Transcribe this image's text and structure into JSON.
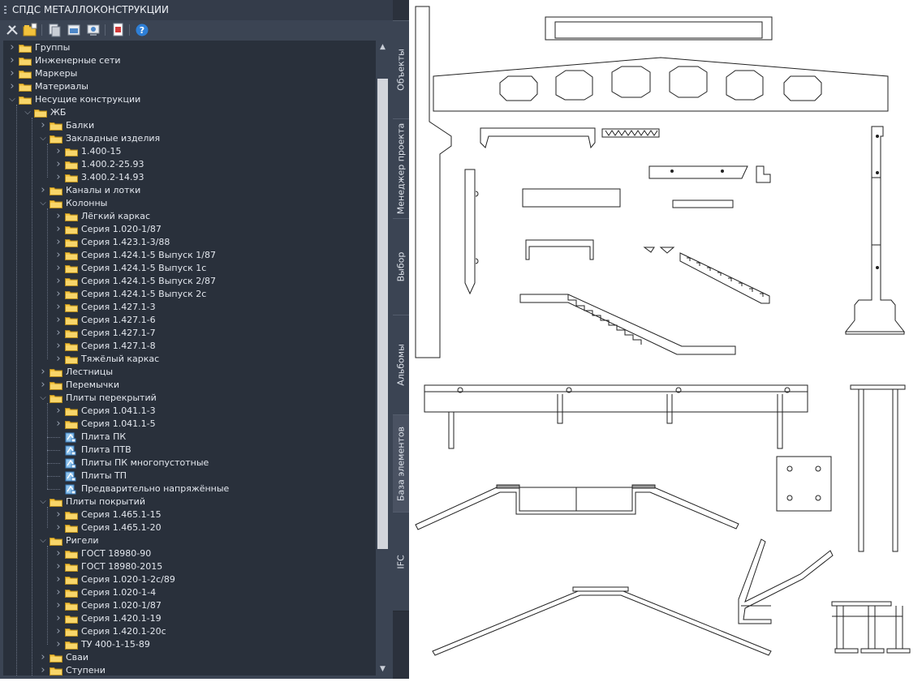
{
  "panel": {
    "title": "СПДС МЕТАЛЛОКОНСТРУКЦИИ"
  },
  "toolbar": [
    {
      "icon": "tools-icon"
    },
    {
      "icon": "open-folder-icon"
    },
    {
      "icon": "copy-icon"
    },
    {
      "icon": "export-icon"
    },
    {
      "icon": "preview-icon"
    },
    {
      "icon": "document-icon"
    },
    {
      "icon": "help-icon"
    }
  ],
  "tree": [
    {
      "level": 0,
      "label": "Группы",
      "expanded": false,
      "type": "folder"
    },
    {
      "level": 0,
      "label": "Инженерные сети",
      "expanded": false,
      "type": "folder"
    },
    {
      "level": 0,
      "label": "Маркеры",
      "expanded": false,
      "type": "folder"
    },
    {
      "level": 0,
      "label": "Материалы",
      "expanded": false,
      "type": "folder"
    },
    {
      "level": 0,
      "label": "Несущие конструкции",
      "expanded": true,
      "type": "folder"
    },
    {
      "level": 1,
      "label": "ЖБ",
      "expanded": true,
      "type": "folder"
    },
    {
      "level": 2,
      "label": "Балки",
      "expanded": false,
      "type": "folder"
    },
    {
      "level": 2,
      "label": "Закладные изделия",
      "expanded": true,
      "type": "folder"
    },
    {
      "level": 3,
      "label": "1.400-15",
      "expanded": false,
      "type": "folder"
    },
    {
      "level": 3,
      "label": "1.400.2-25.93",
      "expanded": false,
      "type": "folder"
    },
    {
      "level": 3,
      "label": "3.400.2-14.93",
      "expanded": false,
      "type": "folder"
    },
    {
      "level": 2,
      "label": "Каналы и лотки",
      "expanded": false,
      "type": "folder"
    },
    {
      "level": 2,
      "label": "Колонны",
      "expanded": true,
      "type": "folder"
    },
    {
      "level": 3,
      "label": "Лёгкий каркас",
      "expanded": false,
      "type": "folder"
    },
    {
      "level": 3,
      "label": "Серия 1.020-1/87",
      "expanded": false,
      "type": "folder"
    },
    {
      "level": 3,
      "label": "Серия 1.423.1-3/88",
      "expanded": false,
      "type": "folder"
    },
    {
      "level": 3,
      "label": "Серия 1.424.1-5 Выпуск 1/87",
      "expanded": false,
      "type": "folder"
    },
    {
      "level": 3,
      "label": "Серия 1.424.1-5 Выпуск 1с",
      "expanded": false,
      "type": "folder"
    },
    {
      "level": 3,
      "label": "Серия 1.424.1-5 Выпуск 2/87",
      "expanded": false,
      "type": "folder"
    },
    {
      "level": 3,
      "label": "Серия 1.424.1-5 Выпуск 2с",
      "expanded": false,
      "type": "folder"
    },
    {
      "level": 3,
      "label": "Серия 1.427.1-3",
      "expanded": false,
      "type": "folder"
    },
    {
      "level": 3,
      "label": "Серия 1.427.1-6",
      "expanded": false,
      "type": "folder"
    },
    {
      "level": 3,
      "label": "Серия 1.427.1-7",
      "expanded": false,
      "type": "folder"
    },
    {
      "level": 3,
      "label": "Серия 1.427.1-8",
      "expanded": false,
      "type": "folder"
    },
    {
      "level": 3,
      "label": "Тяжёлый каркас",
      "expanded": false,
      "type": "folder"
    },
    {
      "level": 2,
      "label": "Лестницы",
      "expanded": false,
      "type": "folder"
    },
    {
      "level": 2,
      "label": "Перемычки",
      "expanded": false,
      "type": "folder"
    },
    {
      "level": 2,
      "label": "Плиты перекрытий",
      "expanded": true,
      "type": "folder"
    },
    {
      "level": 3,
      "label": "Серия 1.041.1-3",
      "expanded": false,
      "type": "folder"
    },
    {
      "level": 3,
      "label": "Серия 1.041.1-5",
      "expanded": false,
      "type": "folder"
    },
    {
      "level": 3,
      "label": "Плита ПК",
      "type": "item"
    },
    {
      "level": 3,
      "label": "Плита ПТВ",
      "type": "item"
    },
    {
      "level": 3,
      "label": "Плиты ПК многопустотные",
      "type": "item"
    },
    {
      "level": 3,
      "label": "Плиты ТП",
      "type": "item"
    },
    {
      "level": 3,
      "label": "Предварительно напряжённые",
      "type": "item"
    },
    {
      "level": 2,
      "label": "Плиты покрытий",
      "expanded": true,
      "type": "folder"
    },
    {
      "level": 3,
      "label": "Серия 1.465.1-15",
      "expanded": false,
      "type": "folder"
    },
    {
      "level": 3,
      "label": "Серия 1.465.1-20",
      "expanded": false,
      "type": "folder"
    },
    {
      "level": 2,
      "label": "Ригели",
      "expanded": true,
      "type": "folder"
    },
    {
      "level": 3,
      "label": "ГОСТ 18980-90",
      "expanded": false,
      "type": "folder"
    },
    {
      "level": 3,
      "label": "ГОСТ 18980-2015",
      "expanded": false,
      "type": "folder"
    },
    {
      "level": 3,
      "label": "Серия 1.020-1-2с/89",
      "expanded": false,
      "type": "folder"
    },
    {
      "level": 3,
      "label": "Серия 1.020-1-4",
      "expanded": false,
      "type": "folder"
    },
    {
      "level": 3,
      "label": "Серия 1.020-1/87",
      "expanded": false,
      "type": "folder"
    },
    {
      "level": 3,
      "label": "Серия 1.420.1-19",
      "expanded": false,
      "type": "folder"
    },
    {
      "level": 3,
      "label": "Серия 1.420.1-20с",
      "expanded": false,
      "type": "folder"
    },
    {
      "level": 3,
      "label": "ТУ 400-1-15-89",
      "expanded": false,
      "type": "folder"
    },
    {
      "level": 2,
      "label": "Сваи",
      "expanded": false,
      "type": "folder"
    },
    {
      "level": 2,
      "label": "Ступени",
      "expanded": false,
      "type": "folder"
    }
  ],
  "tabs": [
    {
      "label": "Объекты",
      "active": false
    },
    {
      "label": "Менеджер проекта",
      "active": false
    },
    {
      "label": "Выбор",
      "active": false
    },
    {
      "label": "Альбомы",
      "active": false
    },
    {
      "label": "База элементов",
      "active": true
    },
    {
      "label": "IFC",
      "active": false
    }
  ],
  "colors": {
    "panel_bg": "#3b4453",
    "tree_bg": "#29303b",
    "folder": "#f5c542",
    "canvas": "#ffffff"
  }
}
